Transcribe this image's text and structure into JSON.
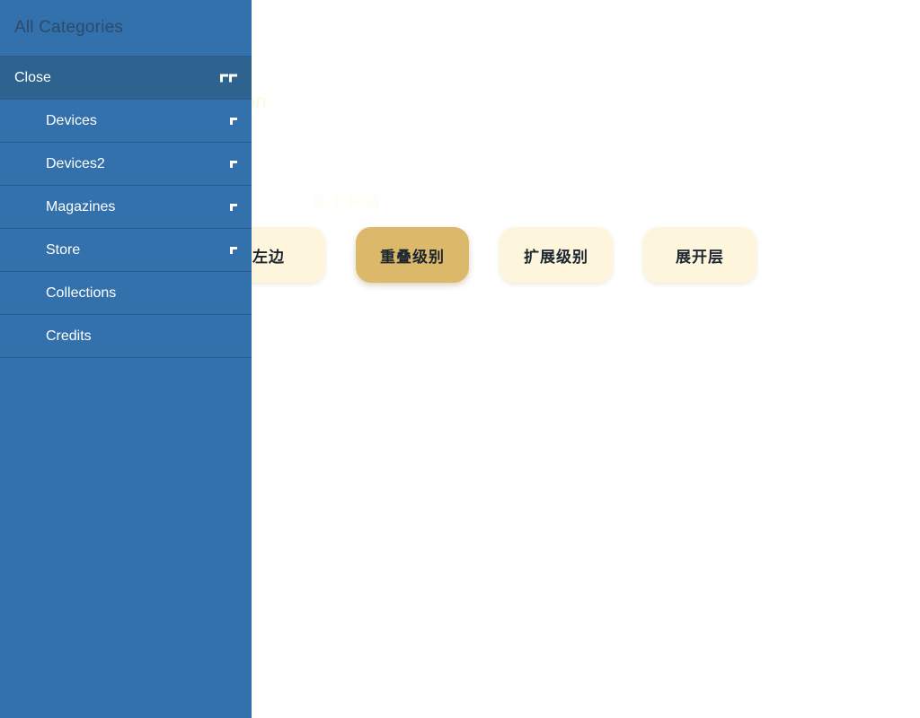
{
  "main": {
    "title": "Navigation",
    "section_label": "关卡开放",
    "hidden_button_label": "左边",
    "buttons": [
      {
        "label": "重叠级别",
        "active": true
      },
      {
        "label": "扩展级别",
        "active": false
      },
      {
        "label": "展开层",
        "active": false
      }
    ],
    "colors": {
      "active_pill": "#dcb96a",
      "pill": "#fdf6dc",
      "pill_text": "#1c2530",
      "background": "#ffffff"
    }
  },
  "sidebar": {
    "header": "All Categories",
    "close_row": {
      "label": "Close",
      "icon": "double-corner-icon"
    },
    "items": [
      {
        "label": "Devices",
        "icon": "corner-icon",
        "indented": true
      },
      {
        "label": "Devices2",
        "icon": "corner-icon",
        "indented": true
      },
      {
        "label": "Magazines",
        "icon": "corner-icon",
        "indented": true
      },
      {
        "label": "Store",
        "icon": "corner-icon",
        "indented": true
      },
      {
        "label": "Collections",
        "icon": "",
        "indented": true
      },
      {
        "label": "Credits",
        "icon": "",
        "indented": true
      }
    ],
    "colors": {
      "background": "#3371ad",
      "active_row": "#2e628f",
      "divider": "#2b5d8c",
      "header_text": "#2c4a69",
      "item_text": "#ffffff"
    }
  }
}
